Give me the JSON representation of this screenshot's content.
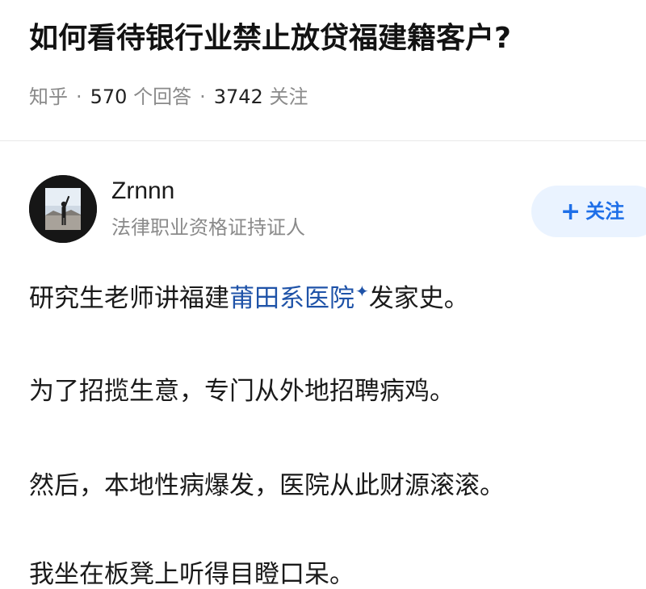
{
  "question": {
    "title": "如何看待银行业禁止放贷福建籍客户?",
    "source": "知乎",
    "answer_count": "570",
    "answer_label": "个回答",
    "follow_count": "3742",
    "follow_label": "关注"
  },
  "answer": {
    "author": {
      "name": "Zrnnn",
      "title": "法律职业资格证持证人",
      "avatar": "user-avatar-photo"
    },
    "follow_button": {
      "label": "关注",
      "icon": "plus-icon"
    },
    "paragraphs": {
      "p1_prefix": "研究生老师讲福建",
      "p1_link": "莆田系医院",
      "p1_suffix": "发家史。",
      "p2": "为了招揽生意，专门从外地招聘病鸡。",
      "p3": "然后，本地性病爆发，医院从此财源滚滚。",
      "p4": "我坐在板凳上听得目瞪口呆。"
    }
  },
  "colors": {
    "link": "#1f53a8",
    "follow_accent": "#1e6fe8",
    "follow_bg": "#eaf3ff",
    "meta_gray": "#8a8a8a"
  }
}
